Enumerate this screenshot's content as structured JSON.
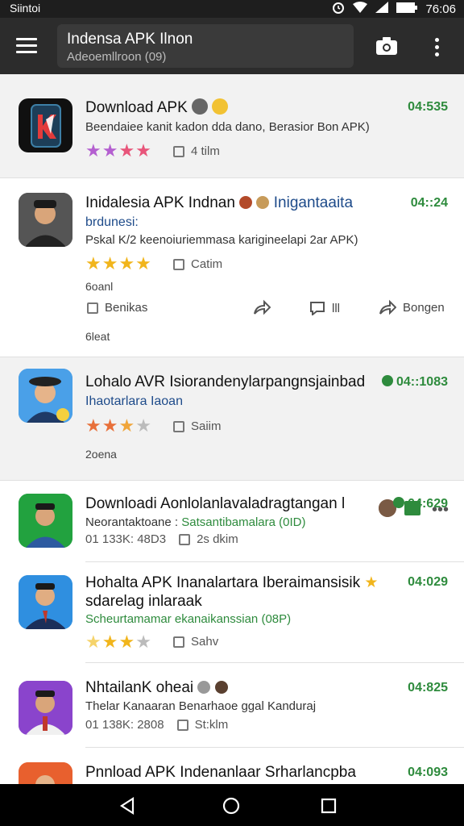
{
  "status": {
    "carrier": "Siintoi",
    "time": "76:06"
  },
  "appbar": {
    "query": "Indensa APK Ilnon",
    "subtitle": "Adeoemllroon (09)"
  },
  "items": [
    {
      "title": "Download APK",
      "desc": "Beendaiee kanit kadon dda dano, Berasior Bon APK)",
      "time": "04:535",
      "meta": "4 tilm"
    },
    {
      "title": "Inidalesia APK Indnan",
      "title_extra": "Inigantaaita",
      "subtitle": "brdunesi:",
      "desc": "Pskal K/2 keenoiuriemmasa karigineelapi 2ar APK)",
      "time": "04::24",
      "meta": "Catim",
      "note_top": "6oanl",
      "actions": [
        "Benikas",
        "lll",
        "Bongen"
      ],
      "note_bottom": "6leat"
    },
    {
      "title": "Lohalo AVR Isiorandenylarpangnsjainbad",
      "subtitle": "Ihaotarlara Iaoan",
      "time": "04::1083",
      "meta": "Saiim",
      "note": "2oena"
    },
    {
      "title": "Downloadi Aonlolanlavaladragtangan l",
      "subtitle_a": "Neorantaktoane :",
      "subtitle_b": "Satsantibamalara (0ID)",
      "stats": "01 133K: 48D3",
      "meta": "2s dkim",
      "time": "04:629"
    },
    {
      "title": "Hohalta APK Inanalartara Iberaimansisik",
      "title2": "sdarelag inlaraak",
      "subtitle": "Scheurtamamar ekanaikanssian (08P)",
      "time": "04:029",
      "meta": "Sahv"
    },
    {
      "title": "NhtailanK oheai",
      "subtitle": "Thelar Kanaaran Benarhaoe ggal Kanduraj",
      "stats": "01 138K: 2808",
      "meta": "St:klm",
      "time": "04:825"
    },
    {
      "title": "Pnnload APK Indenanlaar Srharlancpba",
      "time": "04:093"
    }
  ]
}
